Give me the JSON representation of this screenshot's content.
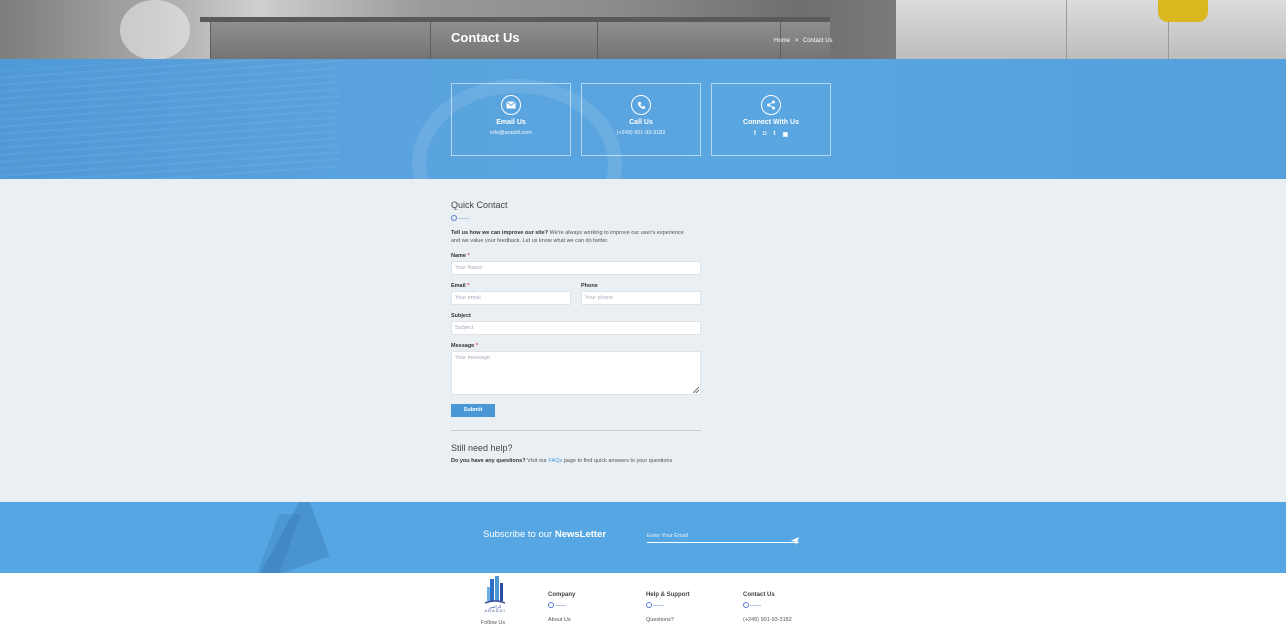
{
  "hero": {
    "title": "Contact Us",
    "breadcrumb": {
      "home": "Home",
      "separator": ">",
      "current": "Contact Us"
    }
  },
  "contact_cards": [
    {
      "icon": "envelope-icon",
      "title": "Email Us",
      "value": "info@araddi.com"
    },
    {
      "icon": "phone-icon",
      "title": "Call Us",
      "value": "(+249) 901-93-3182"
    },
    {
      "icon": "share-icon",
      "title": "Connect With Us",
      "socials": [
        "f",
        "◘",
        "t",
        "▣"
      ]
    }
  ],
  "form": {
    "title": "Quick Contact",
    "intro_bold": "Tell us how we can improve our site?",
    "intro_text": " We're always working to improve our user's experience and we value your feedback. Let us know what we can do better.",
    "name_label": "Name",
    "name_placeholder": "Your Name",
    "email_label": "Email",
    "email_placeholder": "Your email",
    "phone_label": "Phone",
    "phone_placeholder": "Your phone",
    "subject_label": "Subject",
    "subject_placeholder": "Subject",
    "message_label": "Message",
    "message_placeholder": "Your message.",
    "required_mark": "*",
    "submit_label": "Submit"
  },
  "help": {
    "title": "Still need help?",
    "bold": "Do you have any questions?",
    "pre_link": " Visit our ",
    "link": "FAQs",
    "post_link": " page to find quick answers to your questions"
  },
  "newsletter": {
    "prefix": "Subscribe to our ",
    "strong": "NewsLetter",
    "placeholder": "Enter Your Email"
  },
  "footer": {
    "logo_text": "ARADDI",
    "follow": "Follow Us",
    "columns": [
      {
        "heading": "Company",
        "first_item": "About Us"
      },
      {
        "heading": "Help & Support",
        "first_item": "Questions?"
      },
      {
        "heading": "Contact Us",
        "first_item": "(+249) 901-93-3182"
      }
    ]
  },
  "colors": {
    "accent": "#4a97d6",
    "band": "#5aa3de",
    "newsletter": "#55a6e2"
  }
}
